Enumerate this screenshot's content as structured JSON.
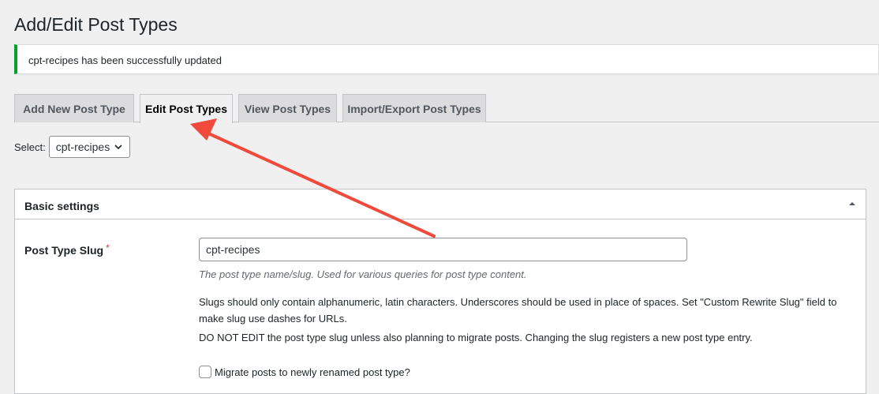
{
  "page": {
    "title": "Add/Edit Post Types"
  },
  "notice": {
    "text": "cpt-recipes has been successfully updated",
    "color": "#00a32a"
  },
  "tabs": [
    {
      "label": "Add New Post Type",
      "active": false
    },
    {
      "label": "Edit Post Types",
      "active": true
    },
    {
      "label": "View Post Types",
      "active": false
    },
    {
      "label": "Import/Export Post Types",
      "active": false
    }
  ],
  "select": {
    "label": "Select:",
    "value": "cpt-recipes"
  },
  "panel": {
    "title": "Basic settings",
    "slug": {
      "label": "Post Type Slug",
      "required_mark": "*",
      "value": "cpt-recipes",
      "hint": "The post type name/slug. Used for various queries for post type content.",
      "desc1": "Slugs should only contain alphanumeric, latin characters. Underscores should be used in place of spaces. Set \"Custom Rewrite Slug\" field to make slug use dashes for URLs.",
      "desc2": "DO NOT EDIT the post type slug unless also planning to migrate posts. Changing the slug registers a new post type entry."
    },
    "migrate": {
      "label": "Migrate posts to newly renamed post type?",
      "checked": false
    }
  },
  "annotation": {
    "color": "#f04a3c"
  }
}
